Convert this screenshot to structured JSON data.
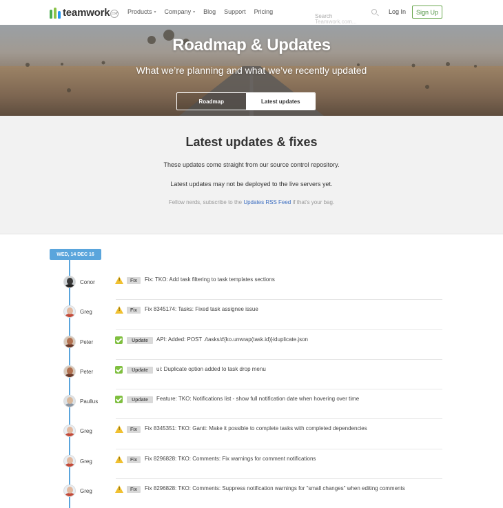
{
  "nav": {
    "brand": "teamwork",
    "brand_suffix": ".com",
    "menu": [
      {
        "label": "Products",
        "caret": true
      },
      {
        "label": "Company",
        "caret": true
      },
      {
        "label": "Blog",
        "caret": false
      },
      {
        "label": "Support",
        "caret": false
      },
      {
        "label": "Pricing",
        "caret": false
      }
    ],
    "search_placeholder": "Search",
    "search_ghost": "Teamwork.com...",
    "login_label": "Log In",
    "signup_label": "Sign Up"
  },
  "hero": {
    "title": "Roadmap & Updates",
    "subtitle": "What we’re planning and what we’ve recently updated",
    "tabs": [
      {
        "label": "Roadmap",
        "active": false
      },
      {
        "label": "Latest updates",
        "active": true
      }
    ]
  },
  "intro": {
    "heading": "Latest updates & fixes",
    "line1": "These updates come straight from our source control repository.",
    "line2": "Latest updates may not be deployed to the live servers yet.",
    "rss_prefix": "Fellow nerds, subscribe to the ",
    "rss_link": "Updates RSS Feed",
    "rss_suffix": " if that's your bag."
  },
  "timeline": {
    "date": "WED, 14 DEC 16",
    "colors": {
      "line": "#5aa5dc",
      "fix": "#f0c030",
      "update": "#7fbf3f"
    },
    "entries": [
      {
        "author": "Conor",
        "type": "fix",
        "tag": "Fix",
        "message": "Fix: TKO: Add task filtering to task templates sections",
        "avatar": "dark"
      },
      {
        "author": "Greg",
        "type": "fix",
        "tag": "Fix",
        "message": "Fix 8345174: Tasks: Fixed task assignee issue",
        "avatar": "light"
      },
      {
        "author": "Peter",
        "type": "update",
        "tag": "Update",
        "message": "API: Added: POST ./tasks/#{ko.unwrap(task.id)}/duplicate.json",
        "avatar": "brown"
      },
      {
        "author": "Peter",
        "type": "update",
        "tag": "Update",
        "message": "ui: Duplicate option added to task drop menu",
        "avatar": "brown"
      },
      {
        "author": "Paullus",
        "type": "update",
        "tag": "Update",
        "message": "Feature: TKO: Notifications list - show full notification date when hovering over time",
        "avatar": "grey"
      },
      {
        "author": "Greg",
        "type": "fix",
        "tag": "Fix",
        "message": "Fix 8345351: TKO: Gantt: Make it possible to complete tasks with completed dependencies",
        "avatar": "light"
      },
      {
        "author": "Greg",
        "type": "fix",
        "tag": "Fix",
        "message": "Fix 8296828: TKO: Comments: Fix warnings for comment notifications",
        "avatar": "light"
      },
      {
        "author": "Greg",
        "type": "fix",
        "tag": "Fix",
        "message": "Fix 8296828: TKO: Comments: Suppress notification warnings for \"small changes\" when editing comments",
        "avatar": "light"
      }
    ]
  }
}
